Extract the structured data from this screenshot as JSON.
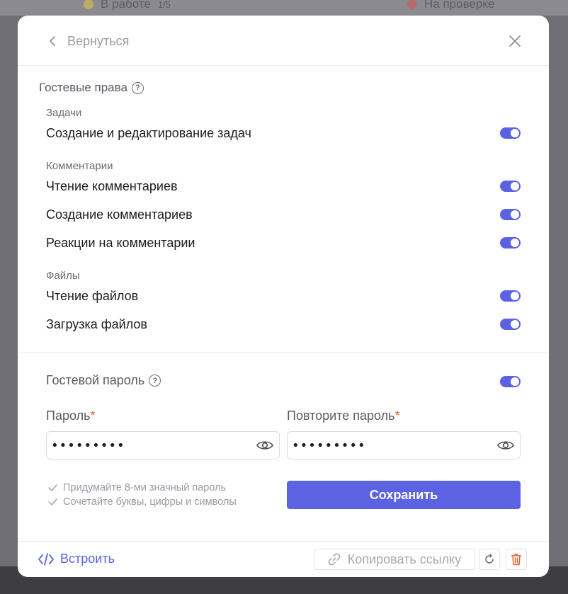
{
  "background": {
    "top_left_chip": "В работе",
    "top_left_count": "1/5",
    "top_right_chip": "На проверке"
  },
  "header": {
    "back_label": "Вернуться"
  },
  "guest_rights": {
    "title": "Гостевые права",
    "groups": [
      {
        "label": "Задачи",
        "items": [
          {
            "label": "Создание и редактирование задач",
            "enabled": true
          }
        ]
      },
      {
        "label": "Комментарии",
        "items": [
          {
            "label": "Чтение комментариев",
            "enabled": true
          },
          {
            "label": "Создание комментариев",
            "enabled": true
          },
          {
            "label": "Реакции на комментарии",
            "enabled": true
          }
        ]
      },
      {
        "label": "Файлы",
        "items": [
          {
            "label": "Чтение файлов",
            "enabled": true
          },
          {
            "label": "Загрузка файлов",
            "enabled": true
          }
        ]
      }
    ]
  },
  "guest_password": {
    "title": "Гостевой пароль",
    "enabled": true,
    "password_label": "Пароль",
    "repeat_label": "Повторите пароль",
    "required_mark": "*",
    "password_value": "123456789",
    "repeat_value": "123456789",
    "hints": [
      "Придумайте 8-ми значный пароль",
      "Сочетайте буквы, цифры и символы"
    ],
    "save_label": "Сохранить"
  },
  "footer": {
    "embed_label": "Встроить",
    "copy_link_label": "Копировать ссылку"
  },
  "colors": {
    "accent": "#5b63e3",
    "required": "#e0622f",
    "delete": "#e0622f"
  }
}
